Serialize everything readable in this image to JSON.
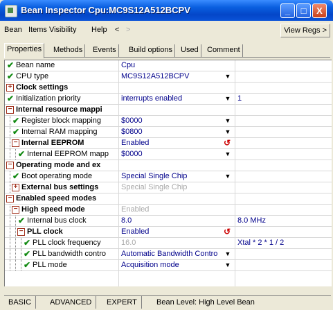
{
  "window": {
    "title": "Bean Inspector Cpu:MC9S12A512BCPV",
    "minimize": "_",
    "maximize": "□",
    "close": "X"
  },
  "menu": {
    "items": [
      "Bean",
      "Items Visibility",
      "Help",
      "<",
      ">"
    ],
    "view_regs": "View Regs >"
  },
  "tabs": [
    "Properties",
    "Methods",
    "Events",
    "Build options",
    "Used",
    "Comment"
  ],
  "rows": [
    {
      "label": "Bean name",
      "value": "Cpu",
      "value_state": "normal",
      "icon": "check",
      "level": 0,
      "bold": false,
      "dropdown": false
    },
    {
      "label": "CPU type",
      "value": "MC9S12A512BCPV",
      "value_state": "normal",
      "icon": "check",
      "level": 0,
      "bold": false,
      "dropdown": true
    },
    {
      "label": "Clock settings",
      "value": "",
      "value_state": "normal",
      "icon": "plus",
      "level": 0,
      "bold": true,
      "dropdown": false
    },
    {
      "label": "Initialization priority",
      "value": "interrupts enabled",
      "extra": "1",
      "value_state": "normal",
      "icon": "check",
      "level": 0,
      "bold": false,
      "dropdown": true
    },
    {
      "label": "Internal resource mappi",
      "value": "",
      "value_state": "normal",
      "icon": "minus",
      "level": 0,
      "bold": true,
      "dropdown": false
    },
    {
      "label": "Register block mapping",
      "value": "$0000",
      "value_state": "normal",
      "icon": "check",
      "level": 1,
      "bold": false,
      "dropdown": true
    },
    {
      "label": "Internal RAM mapping",
      "value": "$0800",
      "value_state": "normal",
      "icon": "check",
      "level": 1,
      "bold": false,
      "dropdown": true
    },
    {
      "label": "Internal EEPROM",
      "value": "Enabled",
      "value_state": "normal",
      "icon": "minus",
      "level": 1,
      "bold": true,
      "dropdown": false,
      "undo": true
    },
    {
      "label": "Internal EEPROM mapp",
      "value": "$0000",
      "value_state": "normal",
      "icon": "check",
      "level": 2,
      "bold": false,
      "dropdown": true
    },
    {
      "label": "Operating mode and ex",
      "value": "",
      "value_state": "normal",
      "icon": "minus",
      "level": 0,
      "bold": true,
      "dropdown": false
    },
    {
      "label": "Boot operating mode",
      "value": "Special Single Chip",
      "value_state": "normal",
      "icon": "check",
      "level": 1,
      "bold": false,
      "dropdown": true
    },
    {
      "label": "External bus settings",
      "value": "Special Single Chip",
      "value_state": "disabled",
      "icon": "plus",
      "level": 1,
      "bold": true,
      "dropdown": false
    },
    {
      "label": "Enabled speed modes",
      "value": "",
      "value_state": "normal",
      "icon": "minus",
      "level": 0,
      "bold": true,
      "dropdown": false
    },
    {
      "label": "High speed mode",
      "value": "Enabled",
      "value_state": "disabled",
      "icon": "minus",
      "level": 1,
      "bold": true,
      "dropdown": false
    },
    {
      "label": "Internal bus clock",
      "value": "8.0",
      "extra": "8.0 MHz",
      "value_state": "normal",
      "icon": "check",
      "level": 2,
      "bold": false,
      "dropdown": false
    },
    {
      "label": "PLL clock",
      "value": "Enabled",
      "value_state": "normal",
      "icon": "minus",
      "level": 2,
      "bold": true,
      "dropdown": false,
      "undo": true
    },
    {
      "label": "PLL clock frequency",
      "value": "16.0",
      "extra": "Xtal * 2 * 1 / 2",
      "value_state": "disabled",
      "icon": "check",
      "level": 3,
      "bold": false,
      "dropdown": false
    },
    {
      "label": "PLL bandwidth contro",
      "value": "Automatic Bandwidth Contro",
      "value_state": "normal",
      "icon": "check",
      "level": 3,
      "bold": false,
      "dropdown": true
    },
    {
      "label": "PLL mode",
      "value": "Acquisition mode",
      "value_state": "normal",
      "icon": "check",
      "level": 3,
      "bold": false,
      "dropdown": true
    }
  ],
  "status": {
    "basic": "BASIC",
    "advanced": "ADVANCED",
    "expert": "EXPERT",
    "level": "Bean Level: High Level Bean"
  },
  "colors": {
    "title_blue": "#0446c8",
    "value_blue": "#00008b",
    "check_green": "#128a12",
    "box_red": "#a0301c",
    "disabled_gray": "#a8a8a8"
  }
}
